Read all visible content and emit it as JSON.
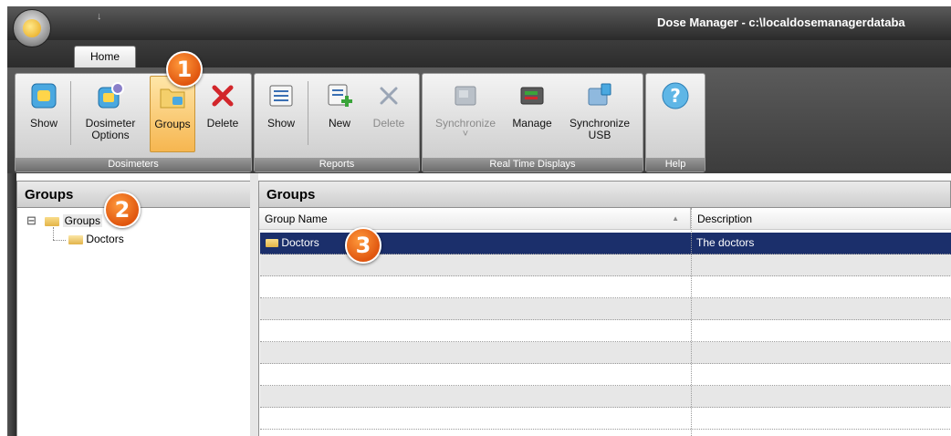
{
  "window": {
    "title": "Dose Manager - c:\\localdosemanagerdataba",
    "qat_glyph": "↓"
  },
  "tabs": [
    {
      "label": "Home"
    }
  ],
  "ribbon": {
    "groups": [
      {
        "label": "Dosimeters",
        "buttons": [
          {
            "label": "Show",
            "icon": "show-dosimeter-icon"
          },
          {
            "label": "Dosimeter\nOptions",
            "icon": "dosimeter-options-icon"
          },
          {
            "label": "Groups",
            "icon": "groups-icon",
            "active": true
          },
          {
            "label": "Delete",
            "icon": "delete-x-icon"
          }
        ]
      },
      {
        "label": "Reports",
        "buttons": [
          {
            "label": "Show",
            "icon": "show-report-icon"
          },
          {
            "label": "New",
            "icon": "new-report-icon"
          },
          {
            "label": "Delete",
            "icon": "delete-report-icon",
            "disabled": true
          }
        ]
      },
      {
        "label": "Real Time Displays",
        "buttons": [
          {
            "label": "Synchronize",
            "icon": "synchronize-icon",
            "disabled": true,
            "sub": "˅"
          },
          {
            "label": "Manage",
            "icon": "manage-display-icon"
          },
          {
            "label": "Synchronize\nUSB",
            "icon": "synchronize-usb-icon"
          }
        ]
      },
      {
        "label": "Help",
        "buttons": [
          {
            "label": "",
            "icon": "help-icon"
          }
        ]
      }
    ]
  },
  "left_panel": {
    "title": "Groups",
    "tree": {
      "expander": "⊟",
      "root": "Groups",
      "children": [
        "Doctors"
      ]
    }
  },
  "right_panel": {
    "title": "Groups",
    "columns": [
      "Group Name",
      "Description"
    ],
    "sort_glyph": "▲",
    "rows": [
      {
        "name": "Doctors",
        "description": "The doctors"
      }
    ]
  },
  "callouts": [
    "1",
    "2",
    "3"
  ],
  "colors": {
    "selection": "#1b2f6b",
    "badge": "#e0560f",
    "active_button": "#f6b650"
  }
}
